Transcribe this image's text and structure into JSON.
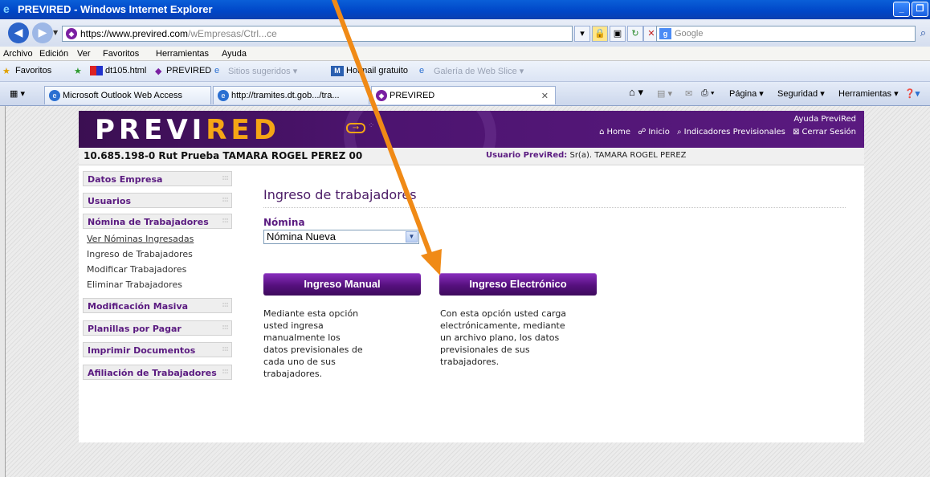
{
  "window": {
    "title": "PREVIRED - Windows Internet Explorer"
  },
  "address_bar": {
    "url_host": "https://www.previred.com",
    "url_path": "/wEmpresas/Ctrl...ce",
    "search_placeholder": "Google"
  },
  "menu": [
    "Archivo",
    "Edición",
    "Ver",
    "Favoritos",
    "Herramientas",
    "Ayuda"
  ],
  "favorites_bar": {
    "label": "Favoritos",
    "items": [
      "dt105.html",
      "PREVIRED",
      "Sitios sugeridos ▾",
      "Hotmail gratuito",
      "Galería de Web Slice ▾"
    ]
  },
  "tabs": [
    {
      "label": "Microsoft Outlook Web Access"
    },
    {
      "label": "http://tramites.dt.gob.../tra..."
    },
    {
      "label": "PREVIRED"
    }
  ],
  "command_bar": [
    "Página ▾",
    "Seguridad ▾",
    "Herramientas ▾"
  ],
  "header": {
    "logo_a": "PREVI",
    "logo_b": "RED",
    "help": "Ayuda PreviRed",
    "nav": [
      "Home",
      "Inicio",
      "Indicadores Previsionales",
      "Cerrar Sesión"
    ]
  },
  "userbar": {
    "rut": "10.685.198-0 Rut Prueba  TAMARA ROGEL PEREZ 00",
    "user_label": "Usuario PreviRed:",
    "user_value": "Sr(a). TAMARA ROGEL PEREZ"
  },
  "sidebar": {
    "datos_empresa": "Datos Empresa",
    "usuarios": "Usuarios",
    "nomina": "Nómina de Trabajadores",
    "nomina_sub": [
      "Ver Nóminas Ingresadas",
      "Ingreso de Trabajadores",
      "Modificar Trabajadores",
      "Eliminar Trabajadores"
    ],
    "modificacion": "Modificación Masiva",
    "planillas": "Planillas por Pagar",
    "imprimir": "Imprimir Documentos",
    "afiliacion": "Afiliación de Trabajadores"
  },
  "main": {
    "title": "Ingreso de trabajadores",
    "nomina_label": "Nómina",
    "nomina_selected": "Nómina Nueva",
    "manual_button": "Ingreso Manual",
    "electronic_button": "Ingreso Electrónico",
    "manual_desc": "Mediante esta opción\nusted ingresa\nmanualmente los\ndatos previsionales de\ncada uno de sus\ntrabajadores.",
    "electronic_desc": "Con esta opción usted carga\nelectrónicamente, mediante\nun archivo plano, los datos\nprevisionales de sus\ntrabajadores."
  },
  "colors": {
    "brand_purple": "#5a1a80",
    "brand_orange": "#f5a515",
    "annotation_arrow": "#f08a16"
  }
}
